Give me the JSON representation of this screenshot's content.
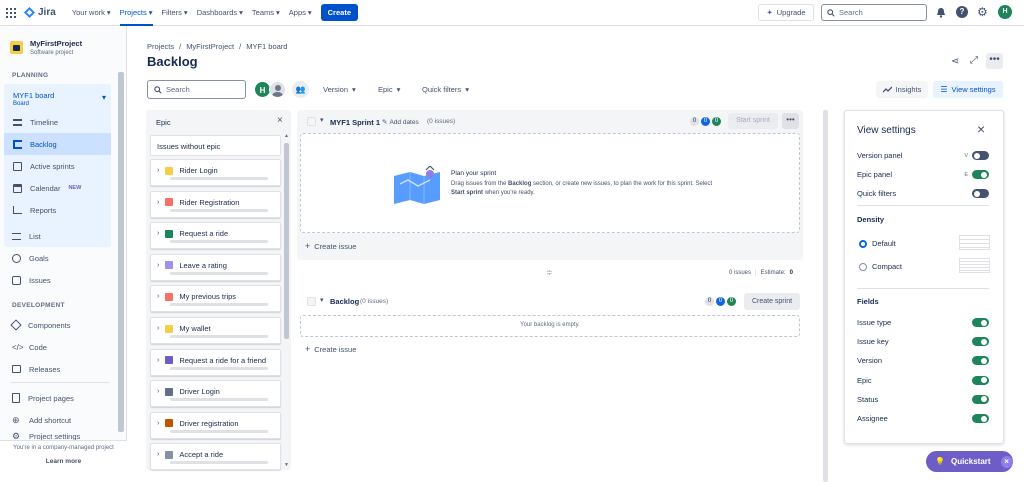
{
  "topnav": {
    "brand": "Jira",
    "items": [
      {
        "label": "Your work",
        "active": false
      },
      {
        "label": "Projects",
        "active": true
      },
      {
        "label": "Filters",
        "active": false
      },
      {
        "label": "Dashboards",
        "active": false
      },
      {
        "label": "Teams",
        "active": false
      },
      {
        "label": "Apps",
        "active": false
      }
    ],
    "create_label": "Create",
    "upgrade_label": "Upgrade",
    "search_placeholder": "Search",
    "avatar_initial": "H"
  },
  "sidebar": {
    "project_name": "MyFirstProject",
    "project_type": "Software project",
    "planning_label": "PLANNING",
    "board_name": "MYF1 board",
    "board_sub": "Board",
    "planning_items": [
      {
        "label": "Timeline",
        "icon": "timeline-icon"
      },
      {
        "label": "Backlog",
        "icon": "backlog-icon"
      },
      {
        "label": "Active sprints",
        "icon": "board-icon"
      },
      {
        "label": "Calendar",
        "icon": "calendar-icon",
        "badge": "NEW"
      },
      {
        "label": "Reports",
        "icon": "reports-icon"
      }
    ],
    "other_items": [
      {
        "label": "List",
        "icon": "list-icon"
      },
      {
        "label": "Goals",
        "icon": "goals-icon"
      },
      {
        "label": "Issues",
        "icon": "issues-icon"
      }
    ],
    "development_label": "DEVELOPMENT",
    "dev_items": [
      {
        "label": "Components",
        "icon": "components-icon"
      },
      {
        "label": "Code",
        "icon": "code-icon"
      },
      {
        "label": "Releases",
        "icon": "releases-icon"
      }
    ],
    "bottom_items": [
      {
        "label": "Project pages",
        "icon": "pages-icon"
      },
      {
        "label": "Add shortcut",
        "icon": "add-shortcut-icon"
      },
      {
        "label": "Project settings",
        "icon": "settings-icon"
      }
    ],
    "footer_text": "You're in a company-managed project",
    "learn_more": "Learn more"
  },
  "breadcrumb": [
    "Projects",
    "MyFirstProject",
    "MYF1 board"
  ],
  "page_title": "Backlog",
  "toolbar": {
    "search_placeholder": "Search",
    "avatar_initial": "H",
    "filters": [
      "Version",
      "Epic",
      "Quick filters"
    ],
    "insights_label": "Insights",
    "view_settings_label": "View settings"
  },
  "epic_panel": {
    "title": "Epic",
    "without_epic": "Issues without epic",
    "epics": [
      {
        "name": "Rider Login",
        "color": "#f5cd47"
      },
      {
        "name": "Rider Registration",
        "color": "#f87168"
      },
      {
        "name": "Request a ride",
        "color": "#1f845a"
      },
      {
        "name": "Leave a rating",
        "color": "#9f8fef"
      },
      {
        "name": "My previous trips",
        "color": "#f87168"
      },
      {
        "name": "My wallet",
        "color": "#f5cd47"
      },
      {
        "name": "Request a ride for a friend",
        "color": "#6e5dc6"
      },
      {
        "name": "Driver Login",
        "color": "#626f86"
      },
      {
        "name": "Driver registration",
        "color": "#c25100"
      },
      {
        "name": "Accept a ride",
        "color": "#8590a2"
      }
    ]
  },
  "sprint": {
    "name": "MYF1 Sprint 1",
    "add_dates": "Add dates",
    "issue_count": "(0 issues)",
    "counts": [
      "0",
      "0",
      "0"
    ],
    "start_label": "Start sprint",
    "plan_title": "Plan your sprint",
    "plan_line1": "Drag issues from the",
    "plan_bold1": "Backlog",
    "plan_line1b": "section, or create new issues, to plan the work for this sprint. Select",
    "plan_bold2": "Start sprint",
    "plan_line2": "when you're ready.",
    "create_issue": "Create issue",
    "footer_issues": "0 issues",
    "footer_estimate_label": "Estimate:",
    "footer_estimate_value": "0"
  },
  "backlog": {
    "name": "Backlog",
    "issue_count": "(0 issues)",
    "counts": [
      "0",
      "0",
      "0"
    ],
    "create_sprint_label": "Create sprint",
    "empty_text": "Your backlog is empty.",
    "create_issue": "Create issue"
  },
  "view_settings": {
    "title": "View settings",
    "toggles": [
      {
        "label": "Version panel",
        "key": "V",
        "on": false
      },
      {
        "label": "Epic panel",
        "key": "E",
        "on": true
      },
      {
        "label": "Quick filters",
        "key": "",
        "on": false
      }
    ],
    "density_label": "Density",
    "density_options": [
      {
        "label": "Default",
        "selected": true
      },
      {
        "label": "Compact",
        "selected": false
      }
    ],
    "fields_label": "Fields",
    "fields": [
      {
        "label": "Issue type",
        "on": true
      },
      {
        "label": "Issue key",
        "on": true
      },
      {
        "label": "Version",
        "on": true
      },
      {
        "label": "Epic",
        "on": true
      },
      {
        "label": "Status",
        "on": true
      },
      {
        "label": "Assignee",
        "on": true
      }
    ]
  },
  "quickstart_label": "Quickstart",
  "colors": {
    "accent": "#0052cc",
    "green": "#1f845a",
    "purple": "#6e5dc6"
  }
}
